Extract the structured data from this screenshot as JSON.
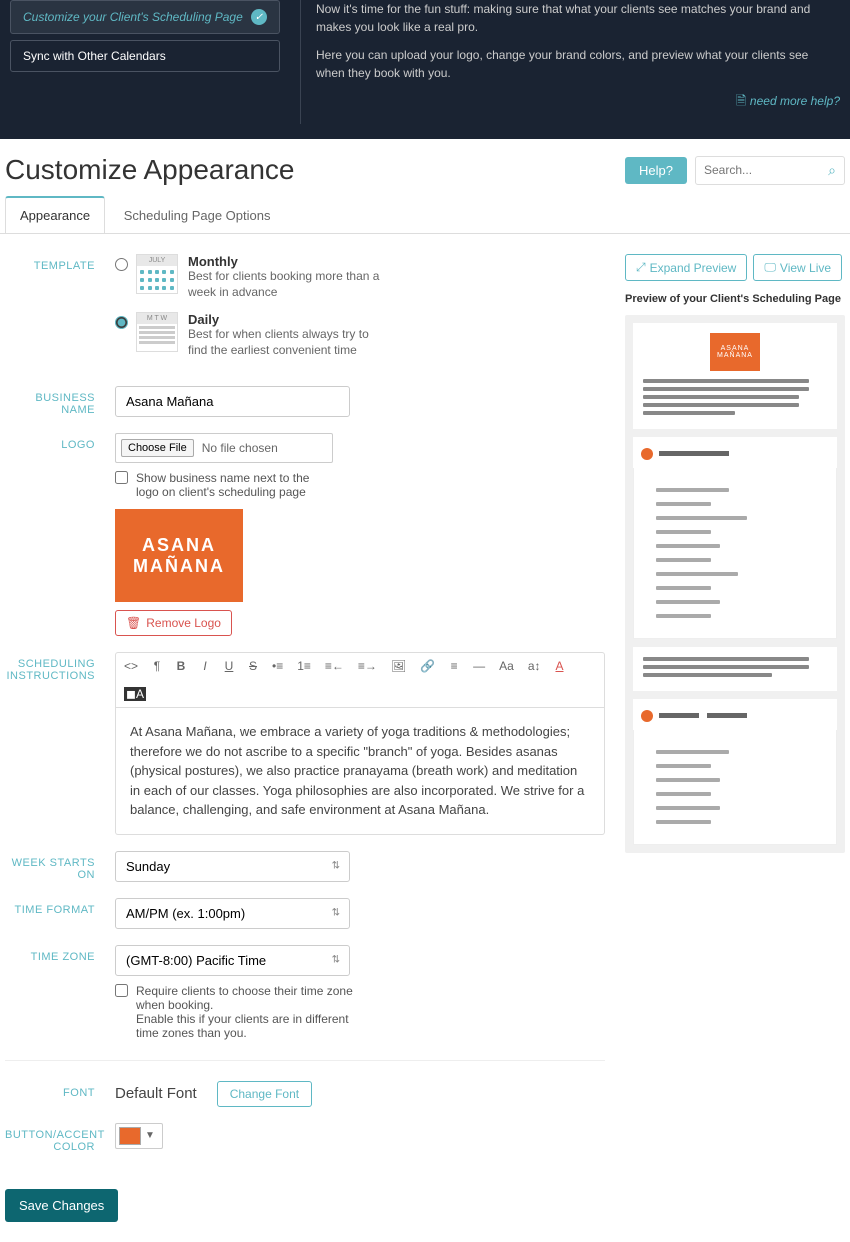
{
  "topBanner": {
    "items": [
      {
        "label": "Customize your Client's Scheduling Page",
        "done": true
      },
      {
        "label": "Sync with Other Calendars",
        "done": false
      }
    ],
    "intro1": "Now it's time for the fun stuff: making sure that what your clients see matches your brand and makes you look like a real pro.",
    "intro2": "Here you can upload your logo, change your brand colors, and preview what your clients see when they book with you.",
    "helpLink": "need more help?"
  },
  "header": {
    "title": "Customize Appearance",
    "helpBtn": "Help?",
    "searchPlaceholder": "Search..."
  },
  "tabs": [
    {
      "label": "Appearance",
      "active": true
    },
    {
      "label": "Scheduling Page Options",
      "active": false
    }
  ],
  "labels": {
    "template": "TEMPLATE",
    "businessName": "BUSINESS NAME",
    "logo": "LOGO",
    "instructions": "SCHEDULING INSTRUCTIONS",
    "weekStarts": "WEEK STARTS ON",
    "timeFormat": "TIME FORMAT",
    "timeZone": "TIME ZONE",
    "font": "FONT",
    "accentColor": "BUTTON/ACCENT COLOR"
  },
  "template": {
    "monthly": {
      "title": "Monthly",
      "desc": "Best for clients booking more than a week in advance",
      "calHead": "JULY"
    },
    "daily": {
      "title": "Daily",
      "desc": "Best for when clients always try to find the earliest convenient time",
      "calHead": "M T W"
    }
  },
  "businessName": "Asana Mañana",
  "logo": {
    "chooseFile": "Choose File",
    "noFile": "No file chosen",
    "showNameChk": "Show business name next to the logo on client's scheduling page",
    "logoLine1": "ASANA",
    "logoLine2": "MAÑANA",
    "removeBtn": "Remove Logo"
  },
  "instructionsText": "At Asana Mañana, we embrace a variety of yoga traditions & methodologies; therefore we do not ascribe to a specific \"branch\" of yoga. Besides asanas (physical postures), we also practice pranayama (breath work) and meditation in each of our classes. Yoga philosophies are also incorporated. We strive for a balance, challenging, and safe environment at Asana Mañana.",
  "weekStarts": "Sunday",
  "timeFormat": "AM/PM (ex. 1:00pm)",
  "timeZone": "(GMT-8:00) Pacific Time",
  "tzHint1": "Require clients to choose their time zone when booking.",
  "tzHint2": "Enable this if your clients are in different time zones than you.",
  "fontValue": "Default Font",
  "changeFont": "Change Font",
  "accentColor": "#e8692c",
  "saveBtn": "Save Changes",
  "preview": {
    "expand": "Expand Preview",
    "viewLive": "View Live",
    "title": "Preview of your Client's Scheduling Page",
    "logoLine1": "ASANA",
    "logoLine2": "MAÑANA"
  },
  "editorIcons": [
    "<>",
    "¶",
    "B",
    "I",
    "U",
    "S",
    "•≡",
    "1≡",
    "≡←",
    "≡→",
    "🖼",
    "🔗",
    "≡",
    "—",
    "Aa",
    "a↕",
    "A",
    "◼A"
  ]
}
